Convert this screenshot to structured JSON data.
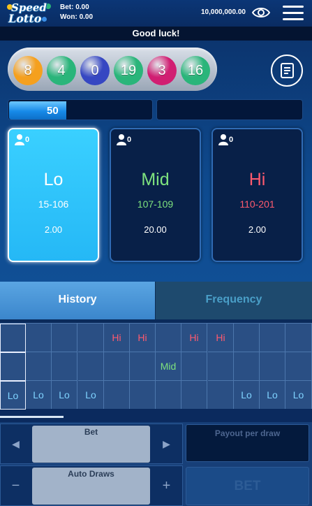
{
  "header": {
    "logo_line1": "Speed",
    "logo_line2": "Lotto",
    "bet_text": "Bet: 0.00",
    "won_text": "Won: 0.00",
    "balance": "10,000,000.00"
  },
  "banner": "Good luck!",
  "balls": [
    {
      "number": "8",
      "color": "#f5a01e"
    },
    {
      "number": "4",
      "color": "#2ab57a"
    },
    {
      "number": "0",
      "color": "#3647c2"
    },
    {
      "number": "19",
      "color": "#2ab57a"
    },
    {
      "number": "3",
      "color": "#d11e72"
    },
    {
      "number": "16",
      "color": "#2ab57a"
    }
  ],
  "progress": {
    "value": "50",
    "fraction": 0.4
  },
  "cards": [
    {
      "name": "Lo",
      "range": "15-106",
      "odds": "2.00",
      "players": "0",
      "name_color": "#ffffff",
      "range_color": "#ffffff",
      "selected": true
    },
    {
      "name": "Mid",
      "range": "107-109",
      "odds": "20.00",
      "players": "0",
      "name_color": "#7ee27e",
      "range_color": "#7ee27e",
      "selected": false
    },
    {
      "name": "Hi",
      "range": "110-201",
      "odds": "2.00",
      "players": "0",
      "name_color": "#ff5a6e",
      "range_color": "#ff5a6e",
      "selected": false
    }
  ],
  "tabs": {
    "history": "History",
    "frequency": "Frequency"
  },
  "history_columns": [
    [
      "",
      "",
      "Lo"
    ],
    [
      "",
      "",
      "Lo"
    ],
    [
      "",
      "",
      "Lo"
    ],
    [
      "",
      "",
      "Lo"
    ],
    [
      "Hi",
      "",
      ""
    ],
    [
      "Hi",
      "",
      ""
    ],
    [
      "",
      "Mid",
      ""
    ],
    [
      "Hi",
      "",
      ""
    ],
    [
      "Hi",
      "",
      ""
    ],
    [
      "",
      "",
      "Lo"
    ],
    [
      "",
      "",
      "Lo"
    ],
    [
      "",
      "",
      "Lo"
    ]
  ],
  "result_colors": {
    "Lo": "#7fd3ff",
    "Mid": "#7ee27e",
    "Hi": "#ff5a6e"
  },
  "controls": {
    "bet_label": "Bet",
    "auto_draws_label": "Auto Draws",
    "payout_label": "Payout per draw",
    "bet_button": "BET",
    "prev_glyph": "◀",
    "next_glyph": "▶",
    "minus_glyph": "−",
    "plus_glyph": "+"
  }
}
